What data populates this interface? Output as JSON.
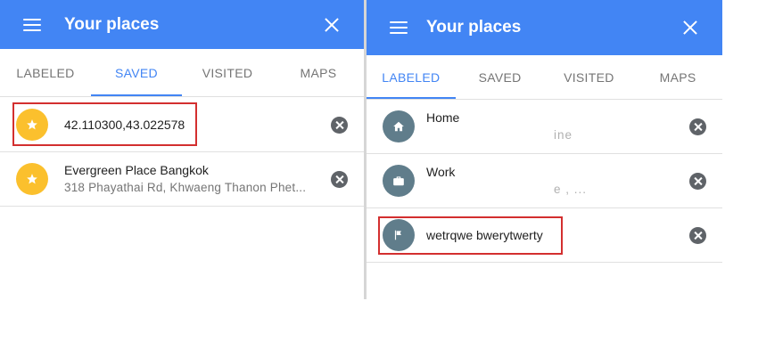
{
  "left_panel": {
    "title": "Your places",
    "tabs": [
      {
        "label": "LABELED",
        "active": false
      },
      {
        "label": "SAVED",
        "active": true
      },
      {
        "label": "VISITED",
        "active": false
      },
      {
        "label": "MAPS",
        "active": false
      }
    ],
    "items": [
      {
        "title": "42.110300,43.022578",
        "subtitle": "",
        "icon": "star-icon"
      },
      {
        "title": "Evergreen Place Bangkok",
        "subtitle": "318 Phayathai Rd, Khwaeng Thanon Phet...",
        "icon": "star-icon"
      }
    ]
  },
  "right_panel": {
    "title": "Your places",
    "tabs": [
      {
        "label": "LABELED",
        "active": true
      },
      {
        "label": "SAVED",
        "active": false
      },
      {
        "label": "VISITED",
        "active": false
      },
      {
        "label": "MAPS",
        "active": false
      }
    ],
    "items": [
      {
        "title": "Home",
        "subtitle": "ine",
        "icon": "home-icon"
      },
      {
        "title": "Work",
        "subtitle": "e , ...",
        "icon": "briefcase-icon"
      },
      {
        "title": "wetrqwe bwerytwerty",
        "subtitle": "",
        "icon": "flag-icon"
      }
    ]
  },
  "colors": {
    "app_bar": "#4285f4",
    "star_avatar": "#fbc02d",
    "label_avatar": "#607d8b",
    "highlight_box": "#d32f2f"
  }
}
